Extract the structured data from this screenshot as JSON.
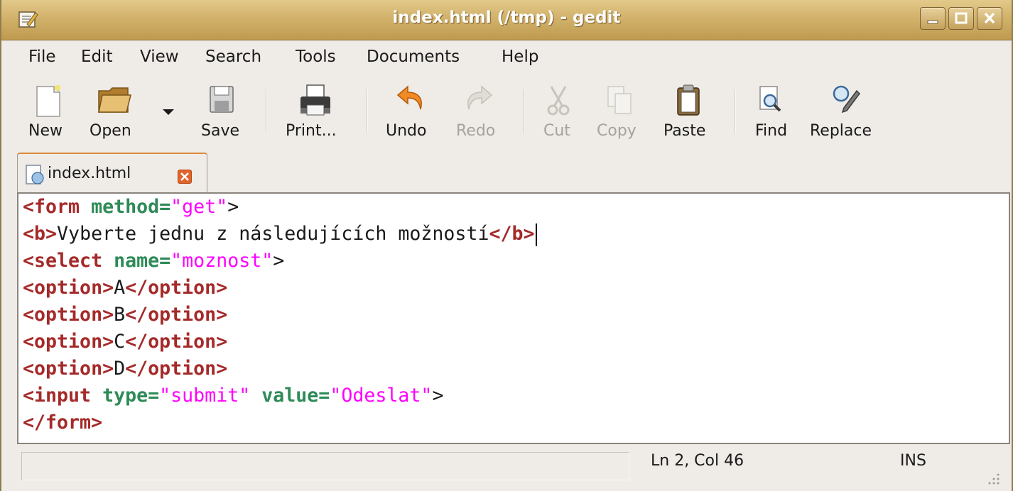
{
  "window": {
    "title": "index.html (/tmp) - gedit",
    "controls": [
      "minimize",
      "maximize",
      "close"
    ]
  },
  "menubar": {
    "items": [
      "File",
      "Edit",
      "View",
      "Search",
      "Tools",
      "Documents",
      "Help"
    ]
  },
  "toolbar": {
    "new_label": "New",
    "open_label": "Open",
    "save_label": "Save",
    "print_label": "Print...",
    "undo_label": "Undo",
    "redo_label": "Redo",
    "cut_label": "Cut",
    "copy_label": "Copy",
    "paste_label": "Paste",
    "find_label": "Find",
    "replace_label": "Replace"
  },
  "tabs": [
    {
      "label": "index.html"
    }
  ],
  "editor": {
    "lines": [
      [
        "<form ",
        "method=",
        "\"get\"",
        ">"
      ],
      [
        "<b>",
        "Vyberte jednu z následujících možností",
        "</b>"
      ],
      [
        "<select ",
        "name=",
        "\"moznost\"",
        ">"
      ],
      [
        "<option>",
        "A",
        "</option>"
      ],
      [
        "<option>",
        "B",
        "</option>"
      ],
      [
        "<option>",
        "C",
        "</option>"
      ],
      [
        "<option>",
        "D",
        "</option>"
      ],
      [
        "<input ",
        "type=",
        "\"submit\"",
        " ",
        "value=",
        "\"Odeslat\"",
        ">"
      ],
      [
        "</form>"
      ]
    ],
    "colors": {
      "tag": "#a52a2a",
      "attribute": "#2e8b57",
      "string": "#ff00ff"
    }
  },
  "statusbar": {
    "position": "Ln 2, Col 46",
    "mode": "INS"
  },
  "icons": [
    "gedit-app-icon",
    "new-icon",
    "open-icon",
    "dropdown-arrow-icon",
    "save-icon",
    "print-icon",
    "undo-icon",
    "redo-icon",
    "cut-icon",
    "copy-icon",
    "paste-icon",
    "find-icon",
    "replace-icon",
    "html-file-icon",
    "close-tab-icon",
    "resize-grip-icon"
  ]
}
